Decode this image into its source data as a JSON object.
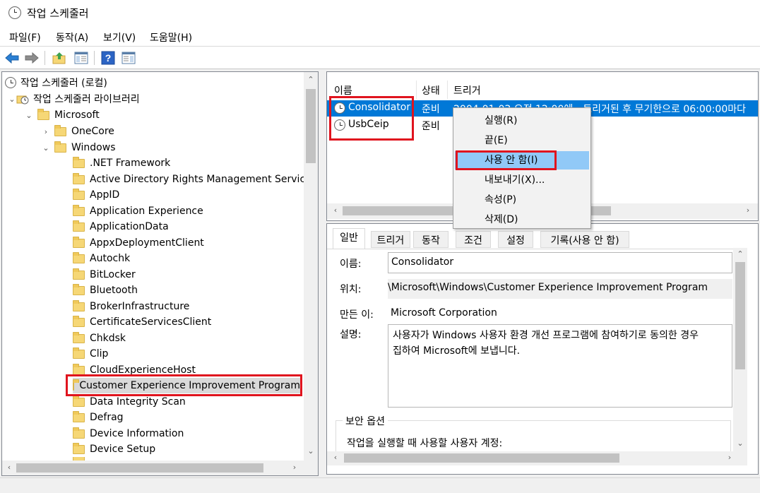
{
  "window": {
    "title": "작업 스케줄러"
  },
  "menu": [
    "파일(F)",
    "동작(A)",
    "보기(V)",
    "도움말(H)"
  ],
  "toolbar": {
    "icons": [
      "back-arrow-icon",
      "forward-arrow-icon",
      "up-folder-icon",
      "show-hide-console-tree-icon",
      "help-icon",
      "show-hide-action-pane-icon"
    ]
  },
  "tree": {
    "root": "작업 스케줄러 (로컬)",
    "library": "작업 스케줄러 라이브러리",
    "microsoft": "Microsoft",
    "onecore": "OneCore",
    "windows": "Windows",
    "items": [
      ".NET Framework",
      "Active Directory Rights Management Services",
      "AppID",
      "Application Experience",
      "ApplicationData",
      "AppxDeploymentClient",
      "Autochk",
      "BitLocker",
      "Bluetooth",
      "BrokerInfrastructure",
      "CertificateServicesClient",
      "Chkdsk",
      "Clip",
      "CloudExperienceHost",
      "Customer Experience Improvement Program",
      "Data Integrity Scan",
      "Defrag",
      "Device Information",
      "Device Setup"
    ],
    "selected": "Customer Experience Improvement Program"
  },
  "tasks": {
    "columns": [
      "이름",
      "상태",
      "트리거"
    ],
    "rows": [
      {
        "name": "Consolidator",
        "status": "준비",
        "trigger": "2004-01-02 오전 12:00에 - 트리거된 후 무기한으로 06:00:00마다"
      },
      {
        "name": "UsbCeip",
        "status": "준비",
        "trigger": ""
      }
    ]
  },
  "context_menu": {
    "items": [
      "실행(R)",
      "끝(E)",
      "사용 안 함(I)",
      "내보내기(X)...",
      "속성(P)",
      "삭제(D)"
    ],
    "highlighted": "사용 안 함(I)"
  },
  "details": {
    "tabs": [
      "일반",
      "트리거",
      "동작",
      "조건",
      "설정",
      "기록(사용 안 함)"
    ],
    "active_tab": "일반",
    "name_label": "이름:",
    "name_value": "Consolidator",
    "location_label": "위치:",
    "location_value": "\\Microsoft\\Windows\\Customer Experience Improvement Program",
    "author_label": "만든 이:",
    "author_value": "Microsoft Corporation",
    "description_label": "설명:",
    "description_line1": "사용자가 Windows 사용자 환경 개선 프로그램에 참여하기로 동의한 경우",
    "description_line2": "집하여 Microsoft에 보냅니다.",
    "security_title": "보안 옵션",
    "security_account_label": "작업을 실행할 때 사용할 사용자 계정:"
  },
  "colors": {
    "selection": "#0078d7",
    "menu_highlight": "#91c9f7",
    "annotation_red": "#e0141e"
  }
}
